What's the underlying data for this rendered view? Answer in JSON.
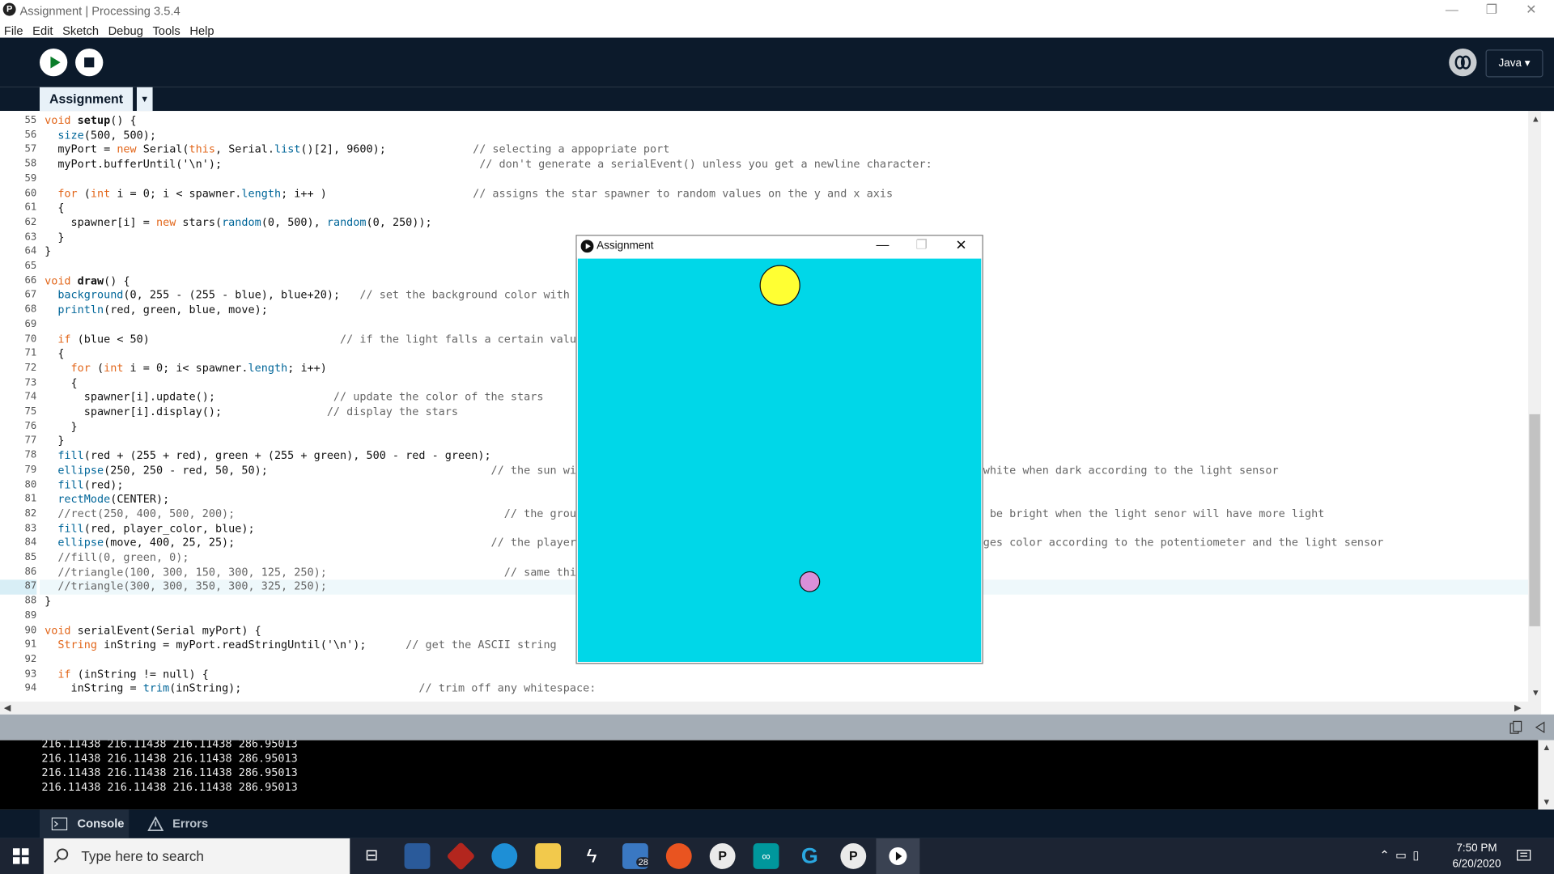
{
  "window": {
    "title": "Assignment | Processing 3.5.4",
    "logo_letter": "P",
    "controls": {
      "minimize": "—",
      "restore": "❐",
      "close": "✕"
    }
  },
  "menu": [
    "File",
    "Edit",
    "Sketch",
    "Debug",
    "Tools",
    "Help"
  ],
  "toolbar": {
    "run_icon": "play-icon",
    "stop_icon": "stop-icon",
    "debugger_icon": "debugger-icon",
    "mode_label": "Java ▾"
  },
  "tabs": {
    "active_tab": "Assignment",
    "tab_menu": "▼"
  },
  "editor": {
    "highlighted_line": 87,
    "lines": [
      {
        "n": "55",
        "code": "void setup() {",
        "comment": ""
      },
      {
        "n": "56",
        "code": "  size(500, 500);",
        "comment": ""
      },
      {
        "n": "57",
        "code": "  myPort = new Serial(this, Serial.list()[2], 9600);",
        "comment": "// selecting a appopriate port"
      },
      {
        "n": "58",
        "code": "  myPort.bufferUntil('\\n');",
        "comment": " // don't generate a serialEvent() unless you get a newline character:"
      },
      {
        "n": "59",
        "code": "",
        "comment": ""
      },
      {
        "n": "60",
        "code": "  for (int i = 0; i < spawner.length; i++ )",
        "comment": "// assigns the star spawner to random values on the y and x axis"
      },
      {
        "n": "61",
        "code": "  {",
        "comment": ""
      },
      {
        "n": "62",
        "code": "    spawner[i] = new stars(random(0, 500), random(0, 250));",
        "comment": ""
      },
      {
        "n": "63",
        "code": "  }",
        "comment": ""
      },
      {
        "n": "64",
        "code": "}",
        "comment": ""
      },
      {
        "n": "65",
        "code": "",
        "comment": ""
      },
      {
        "n": "66",
        "code": "void draw() {",
        "comment": ""
      },
      {
        "n": "67",
        "code": "  background(0, 255 - (255 - blue), blue+20);   // set the background color with t",
        "comment": ""
      },
      {
        "n": "68",
        "code": "  println(red, green, blue, move);",
        "comment": ""
      },
      {
        "n": "69",
        "code": "",
        "comment": ""
      },
      {
        "n": "70",
        "code": "  if (blue < 50)                             // if the light falls a certain valu",
        "comment": ""
      },
      {
        "n": "71",
        "code": "  {",
        "comment": ""
      },
      {
        "n": "72",
        "code": "    for (int i = 0; i< spawner.length; i++)",
        "comment": ""
      },
      {
        "n": "73",
        "code": "    {",
        "comment": ""
      },
      {
        "n": "74",
        "code": "      spawner[i].update();                  // update the color of the stars",
        "comment": ""
      },
      {
        "n": "75",
        "code": "      spawner[i].display();                // display the stars",
        "comment": ""
      },
      {
        "n": "76",
        "code": "    }",
        "comment": ""
      },
      {
        "n": "77",
        "code": "  }",
        "comment": ""
      },
      {
        "n": "78",
        "code": "  fill(red + (255 + red), green + (255 + green), 500 - red - green);",
        "comment": ""
      },
      {
        "n": "79",
        "code": "  ellipse(250, 250 - red, 50, 50);                                  // the sun wil",
        "comment": "white when dark according to the light sensor"
      },
      {
        "n": "80",
        "code": "  fill(red);",
        "comment": ""
      },
      {
        "n": "81",
        "code": "  rectMode(CENTER);",
        "comment": ""
      },
      {
        "n": "82",
        "code": "  //rect(250, 400, 500, 200);                                         // the ground",
        "comment": " be bright when the light senor will have more light"
      },
      {
        "n": "83",
        "code": "  fill(red, player_color, blue);",
        "comment": ""
      },
      {
        "n": "84",
        "code": "  ellipse(move, 400, 25, 25);                                       // the player o",
        "comment": "ges color according to the potentiometer and the light sensor"
      },
      {
        "n": "85",
        "code": "  //fill(0, green, 0);",
        "comment": ""
      },
      {
        "n": "86",
        "code": "  //triangle(100, 300, 150, 300, 125, 250);                           // same thing",
        "comment": ""
      },
      {
        "n": "87",
        "code": "  //triangle(300, 300, 350, 300, 325, 250);",
        "comment": ""
      },
      {
        "n": "88",
        "code": "}",
        "comment": ""
      },
      {
        "n": "89",
        "code": "",
        "comment": ""
      },
      {
        "n": "90",
        "code": "void serialEvent(Serial myPort) {",
        "comment": ""
      },
      {
        "n": "91",
        "code": "  String inString = myPort.readStringUntil('\\n');      // get the ASCII string",
        "comment": ""
      },
      {
        "n": "92",
        "code": "",
        "comment": ""
      },
      {
        "n": "93",
        "code": "  if (inString != null) {",
        "comment": ""
      },
      {
        "n": "94",
        "code": "    inString = trim(inString);                           // trim off any whitespace:",
        "comment": ""
      }
    ]
  },
  "console": {
    "lines": [
      "216.11438 216.11438 216.11438 286.95013",
      "216.11438 216.11438 216.11438 286.95013",
      "216.11438 216.11438 216.11438 286.95013",
      "216.11438 216.11438 216.11438 286.95013"
    ],
    "tabs": {
      "console": "Console",
      "errors": "Errors"
    }
  },
  "sketch_window": {
    "title": "Assignment",
    "background_color": "#00d7e8",
    "sun_color": "#ffff33",
    "player_color": "#d990d9"
  },
  "taskbar": {
    "search_placeholder": "Type here to search",
    "mail_badge": "28",
    "time": "7:50 PM",
    "date": "6/20/2020"
  },
  "colors": {
    "toolbar_bg": "#0c1a2b",
    "keyword_orange": "#e2661a",
    "function_blue": "#006699",
    "comment_gray": "#666666"
  }
}
